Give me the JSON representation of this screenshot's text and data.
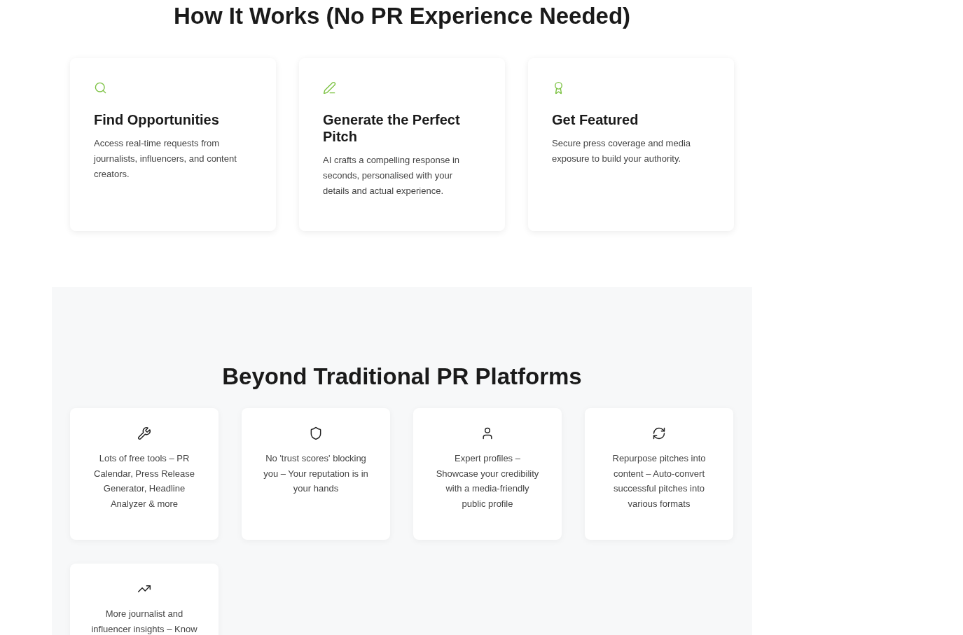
{
  "how_it_works": {
    "title": "How It Works (No PR Experience Needed)",
    "steps": [
      {
        "title": "Find Opportunities",
        "description": "Access real-time requests from journalists, influencers, and content creators."
      },
      {
        "title": "Generate the Perfect Pitch",
        "description": "AI crafts a compelling response in seconds, personalised with your details and actual experience."
      },
      {
        "title": "Get Featured",
        "description": "Secure press coverage and media exposure to build your authority."
      }
    ]
  },
  "beyond": {
    "title": "Beyond Traditional PR Platforms",
    "features": [
      {
        "text": "Lots of free tools – PR Calendar, Press Release Generator, Headline Analyzer & more"
      },
      {
        "text": "No 'trust scores' blocking you – Your reputation is in your hands"
      },
      {
        "text": "Expert profiles – Showcase your credibility with a media-friendly public profile"
      },
      {
        "text": "Repurpose pitches into content – Auto-convert successful pitches into various formats"
      },
      {
        "text": "More journalist and influencer insights – Know"
      }
    ]
  }
}
